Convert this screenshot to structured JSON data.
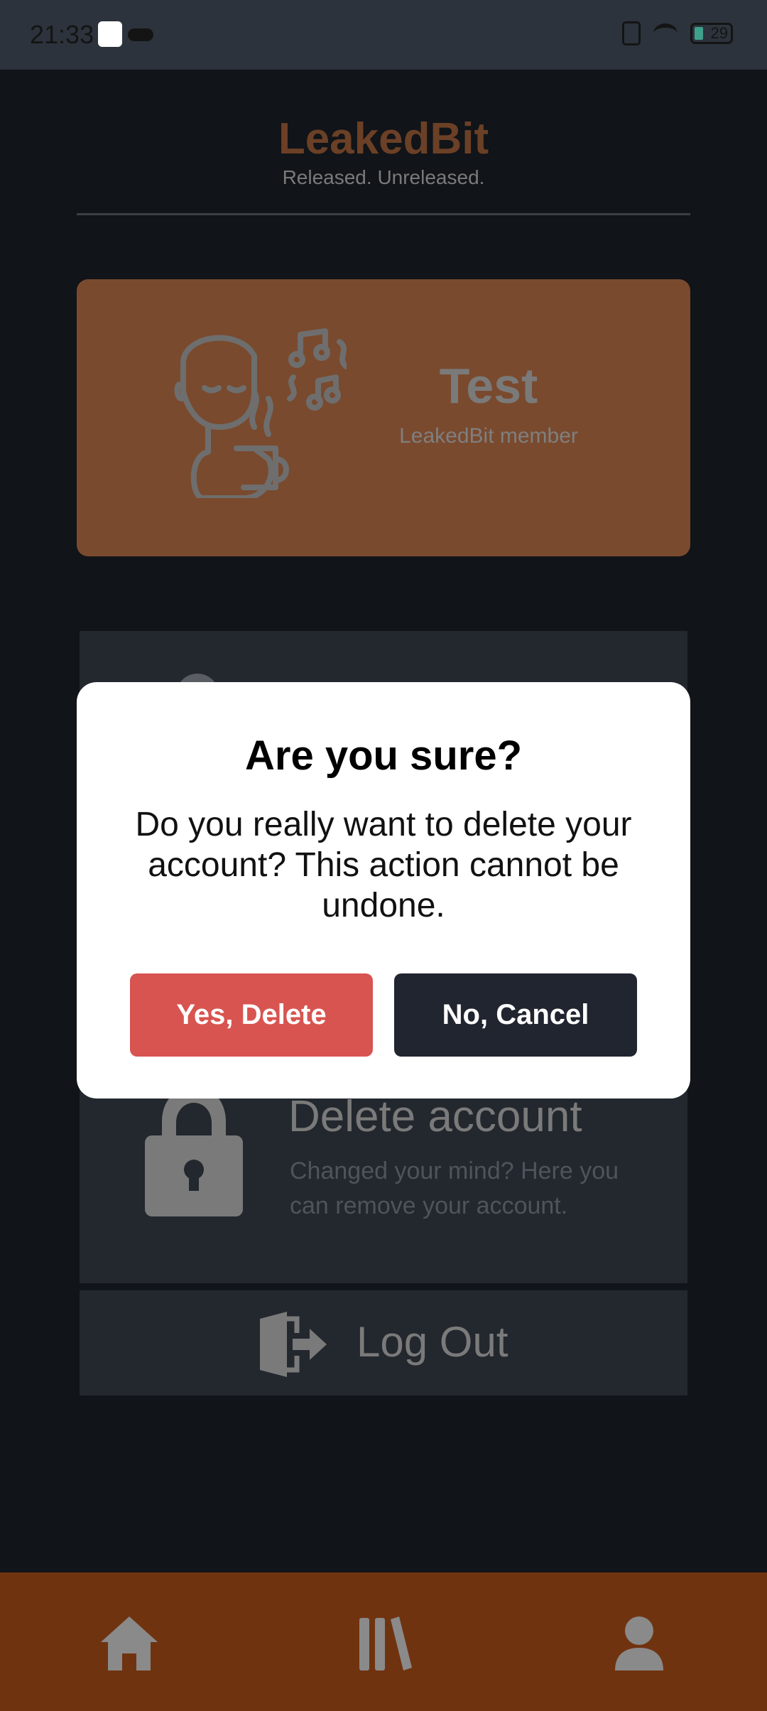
{
  "status_bar": {
    "time": "21:33",
    "battery_level": "29"
  },
  "app": {
    "title": "LeakedBit",
    "subtitle": "Released. Unreleased."
  },
  "profile": {
    "name": "Test",
    "role": "LeakedBit member"
  },
  "settings": {
    "delete_account": {
      "title": "Delete account",
      "description": "Changed your mind? Here you can remove your account."
    },
    "logout_label": "Log Out"
  },
  "dialog": {
    "title": "Are you sure?",
    "message": "Do you really want to delete your account? This action cannot be undone.",
    "confirm_label": "Yes, Delete",
    "cancel_label": "No, Cancel"
  },
  "bottom_nav": {
    "items": [
      {
        "icon": "home-icon"
      },
      {
        "icon": "library-icon"
      },
      {
        "icon": "profile-icon"
      }
    ]
  },
  "colors": {
    "accent": "#7a4a2e",
    "nav_background": "#703310",
    "danger": "#d85450",
    "dark_button": "#202530"
  }
}
